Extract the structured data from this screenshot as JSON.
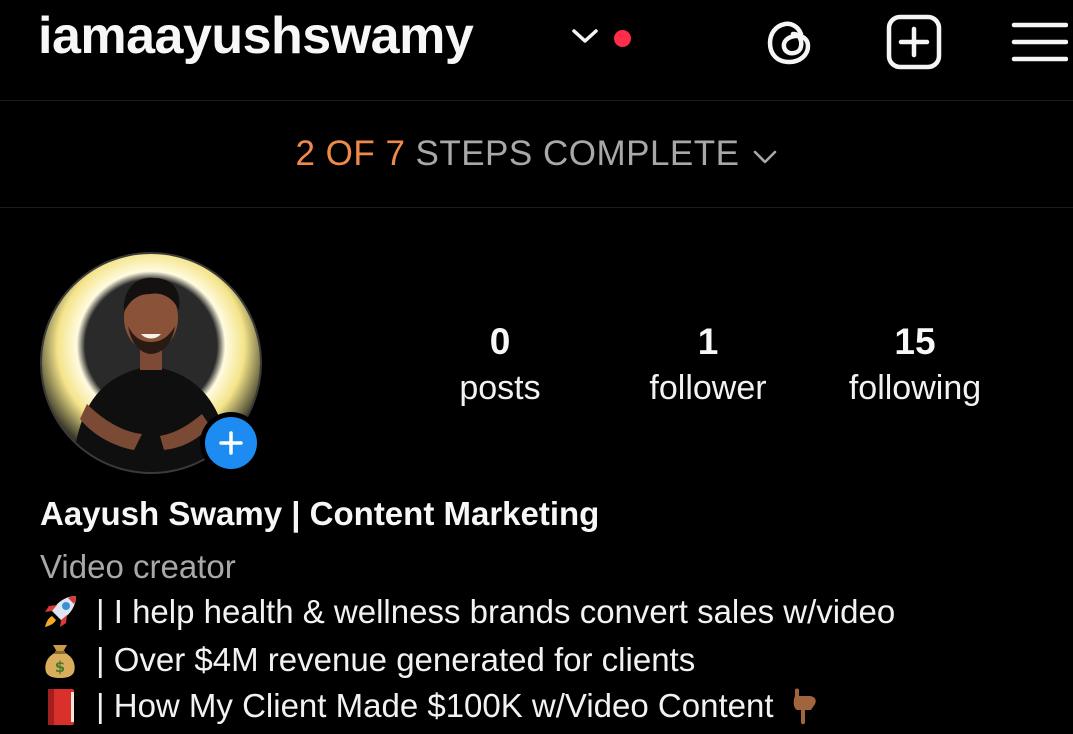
{
  "header": {
    "username": "iamaayushswamy",
    "icons": [
      "chevron-down-icon",
      "notification-dot",
      "threads-icon",
      "create-icon",
      "menu-icon"
    ],
    "notification_color": "#ff2d4a"
  },
  "steps": {
    "progress": "2 OF 7",
    "label": "STEPS COMPLETE",
    "completed": 2,
    "total": 7,
    "accent": "#f08a4b"
  },
  "profile": {
    "stats": {
      "posts": {
        "value": "0",
        "label": "posts"
      },
      "followers": {
        "value": "1",
        "label": "follower"
      },
      "following": {
        "value": "15",
        "label": "following"
      }
    },
    "display_name": "Aayush Swamy | Content Marketing",
    "category": "Video creator",
    "bio": [
      {
        "icon": "rocket-emoji",
        "text": "| I help health & wellness brands convert sales w/video"
      },
      {
        "icon": "money-bag-emoji",
        "text": "| Over $4M revenue generated for clients"
      },
      {
        "icon": "red-book-emoji",
        "text": "| How My Client Made $100K w/Video Content",
        "trailing_icon": "pointing-down-emoji"
      }
    ],
    "add_story_color": "#1d8cf2"
  }
}
